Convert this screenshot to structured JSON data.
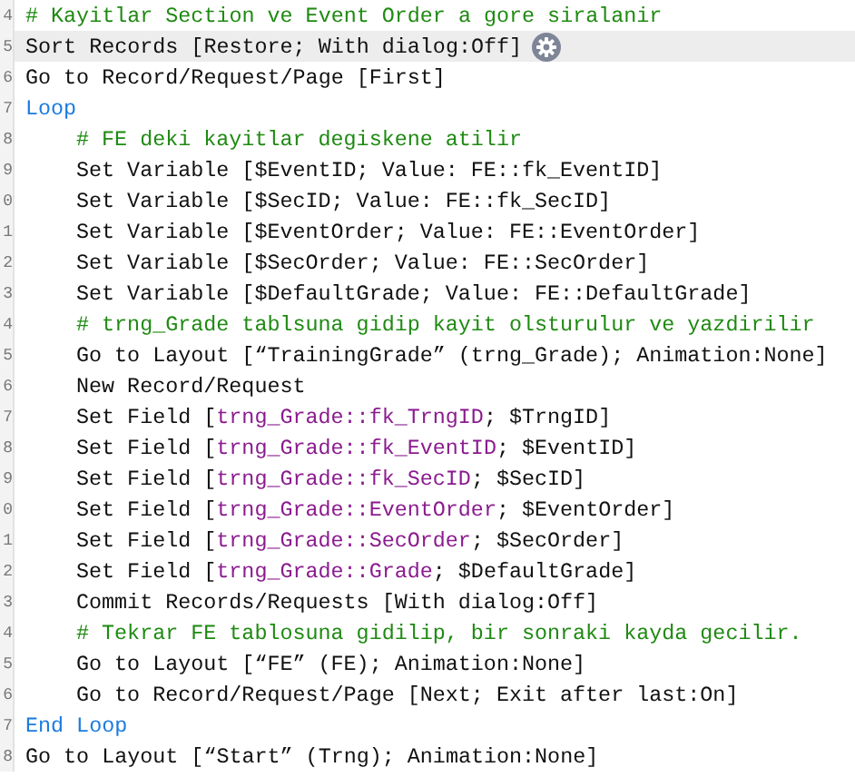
{
  "script_lines": [
    {
      "number": "4",
      "kind": "comment",
      "selected": false,
      "text": "# Kayitlar Section ve Event Order a gore siralanir"
    },
    {
      "number": "5",
      "kind": "step",
      "selected": true,
      "options_icon": true,
      "text": "Sort Records [Restore; With dialog:Off]"
    },
    {
      "number": "6",
      "kind": "step",
      "selected": false,
      "text": "Go to Record/Request/Page [First]"
    },
    {
      "number": "7",
      "kind": "control",
      "selected": false,
      "text": "Loop",
      "children": [
        {
          "number": "8",
          "kind": "comment",
          "selected": false,
          "text": "# FE deki kayitlar degiskene atilir"
        },
        {
          "number": "9",
          "kind": "step",
          "selected": false,
          "text": "Set Variable [$EventID; Value: FE::fk_EventID]"
        },
        {
          "number": "0",
          "kind": "step",
          "selected": false,
          "text": "Set Variable [$SecID; Value: FE::fk_SecID]"
        },
        {
          "number": "1",
          "kind": "step",
          "selected": false,
          "text": "Set Variable [$EventOrder; Value: FE::EventOrder]"
        },
        {
          "number": "2",
          "kind": "step",
          "selected": false,
          "text": "Set Variable [$SecOrder; Value: FE::SecOrder]"
        },
        {
          "number": "3",
          "kind": "step",
          "selected": false,
          "text": "Set Variable [$DefaultGrade; Value: FE::DefaultGrade]"
        },
        {
          "number": "4",
          "kind": "comment",
          "selected": false,
          "text": "# trng_Grade tablsuna gidip kayit olsturulur ve yazdirilir"
        },
        {
          "number": "5",
          "kind": "step",
          "selected": false,
          "text": "Go to Layout [“TrainingGrade” (trng_Grade); Animation:None]"
        },
        {
          "number": "6",
          "kind": "step",
          "selected": false,
          "text": "New Record/Request"
        },
        {
          "number": "7",
          "kind": "step",
          "selected": false,
          "parts": [
            {
              "kind": "plain",
              "text": "Set Field ["
            },
            {
              "kind": "field",
              "text": "trng_Grade::fk_TrngID"
            },
            {
              "kind": "plain",
              "text": "; $TrngID]"
            }
          ]
        },
        {
          "number": "8",
          "kind": "step",
          "selected": false,
          "parts": [
            {
              "kind": "plain",
              "text": "Set Field ["
            },
            {
              "kind": "field",
              "text": "trng_Grade::fk_EventID"
            },
            {
              "kind": "plain",
              "text": "; $EventID]"
            }
          ]
        },
        {
          "number": "9",
          "kind": "step",
          "selected": false,
          "parts": [
            {
              "kind": "plain",
              "text": "Set Field ["
            },
            {
              "kind": "field",
              "text": "trng_Grade::fk_SecID"
            },
            {
              "kind": "plain",
              "text": "; $SecID]"
            }
          ]
        },
        {
          "number": "0",
          "kind": "step",
          "selected": false,
          "parts": [
            {
              "kind": "plain",
              "text": "Set Field ["
            },
            {
              "kind": "field",
              "text": "trng_Grade::EventOrder"
            },
            {
              "kind": "plain",
              "text": "; $EventOrder]"
            }
          ]
        },
        {
          "number": "1",
          "kind": "step",
          "selected": false,
          "parts": [
            {
              "kind": "plain",
              "text": "Set Field ["
            },
            {
              "kind": "field",
              "text": "trng_Grade::SecOrder"
            },
            {
              "kind": "plain",
              "text": "; $SecOrder]"
            }
          ]
        },
        {
          "number": "2",
          "kind": "step",
          "selected": false,
          "parts": [
            {
              "kind": "plain",
              "text": "Set Field ["
            },
            {
              "kind": "field",
              "text": "trng_Grade::Grade"
            },
            {
              "kind": "plain",
              "text": "; $DefaultGrade]"
            }
          ]
        },
        {
          "number": "3",
          "kind": "step",
          "selected": false,
          "text": "Commit Records/Requests [With dialog:Off]"
        },
        {
          "number": "4",
          "kind": "comment",
          "selected": false,
          "text": "# Tekrar FE tablosuna gidilip, bir sonraki kayda gecilir."
        },
        {
          "number": "5",
          "kind": "step",
          "selected": false,
          "text": "Go to Layout [“FE” (FE); Animation:None]"
        },
        {
          "number": "6",
          "kind": "step",
          "selected": false,
          "text": "Go to Record/Request/Page [Next; Exit after last:On]"
        }
      ]
    },
    {
      "number": "7",
      "kind": "control",
      "selected": false,
      "text": "End Loop"
    },
    {
      "number": "8",
      "kind": "step",
      "selected": false,
      "text": "Go to Layout [“Start” (Trng); Animation:None]"
    }
  ]
}
